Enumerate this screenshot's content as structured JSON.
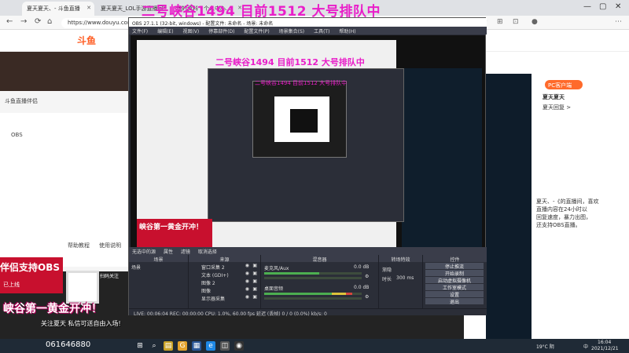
{
  "browser": {
    "tabs": [
      {
        "label": "夏天夏天、- 斗鱼直播"
      },
      {
        "label": "夏天夏天_LOL手游直播间..."
      },
      {
        "label": "我的资料 - 个人中心..."
      }
    ],
    "url": "https://www.douyu.com/...",
    "site_logo": "斗鱼"
  },
  "overlay": {
    "title": "二号峡谷1494 目前1512 大号排队中",
    "obs_support_banner": "伴侣支持OBS",
    "banner_sub": "已上线",
    "watermark_big": "峡谷第一黄金开冲！",
    "watermark_sub": "关注夏天 私信可送自由入场!",
    "watermark_num": "061646880",
    "qr_text": "扫码关注"
  },
  "left_panel": {
    "item1": "斗鱼直播伴侣",
    "item2": "OBS",
    "btn1": "帮助教程",
    "btn2": "使用说明"
  },
  "right_panel": {
    "pc_badge": "PC客户端",
    "name": "夏天夏天",
    "subtitle": "夏天回复 >",
    "desc1": "夏天、-《的直播间，喜欢",
    "desc2": "直播内容在24小时以",
    "desc3": "回复速度，暴力出图，",
    "desc4": "还支持OBS直播。"
  },
  "obs": {
    "title": "OBS 27.1.1 (32-bit, windows) - 配置文件: 未命名 - 场景: 未命名",
    "menu": [
      "文件(F)",
      "编辑(E)",
      "视图(V)",
      "停靠部件(D)",
      "配置文件(P)",
      "场景集合(S)",
      "工具(T)",
      "帮助(H)"
    ],
    "source_bar": [
      "无选中的源",
      "属性",
      "滤镜",
      "取消选择"
    ],
    "docks": {
      "scenes": "场景",
      "sources": "来源",
      "mixer": "混音器",
      "transitions": "转场特效",
      "controls": "控件"
    },
    "scene_items": [
      "场景"
    ],
    "source_items": [
      {
        "label": "窗口采集 2"
      },
      {
        "label": "文本 (GDI+)"
      },
      {
        "label": "图像 2"
      },
      {
        "label": "图像"
      },
      {
        "label": "显示器采集"
      }
    ],
    "mixer": {
      "ch1": "麦克风/Aux",
      "ch2": "桌面音频",
      "db1": "0.0 dB",
      "db2": "0.0 dB"
    },
    "transition": {
      "type": "渐隐",
      "duration_label": "时长",
      "duration": "300 ms"
    },
    "controls": [
      "停止推流",
      "开始录制",
      "启动虚拟摄像机",
      "工作室模式",
      "设置",
      "退出"
    ],
    "status": "LIVE: 00:06:04   REC: 00:00:00   CPU: 1.0%, 60.00 fps   延迟 (丢帧) 0 / 0 (0.0%)   kb/s: 0"
  },
  "taskbar": {
    "weather": "19°C 阴",
    "time": "16:04",
    "date": "2021/12/21",
    "lang": "中"
  }
}
